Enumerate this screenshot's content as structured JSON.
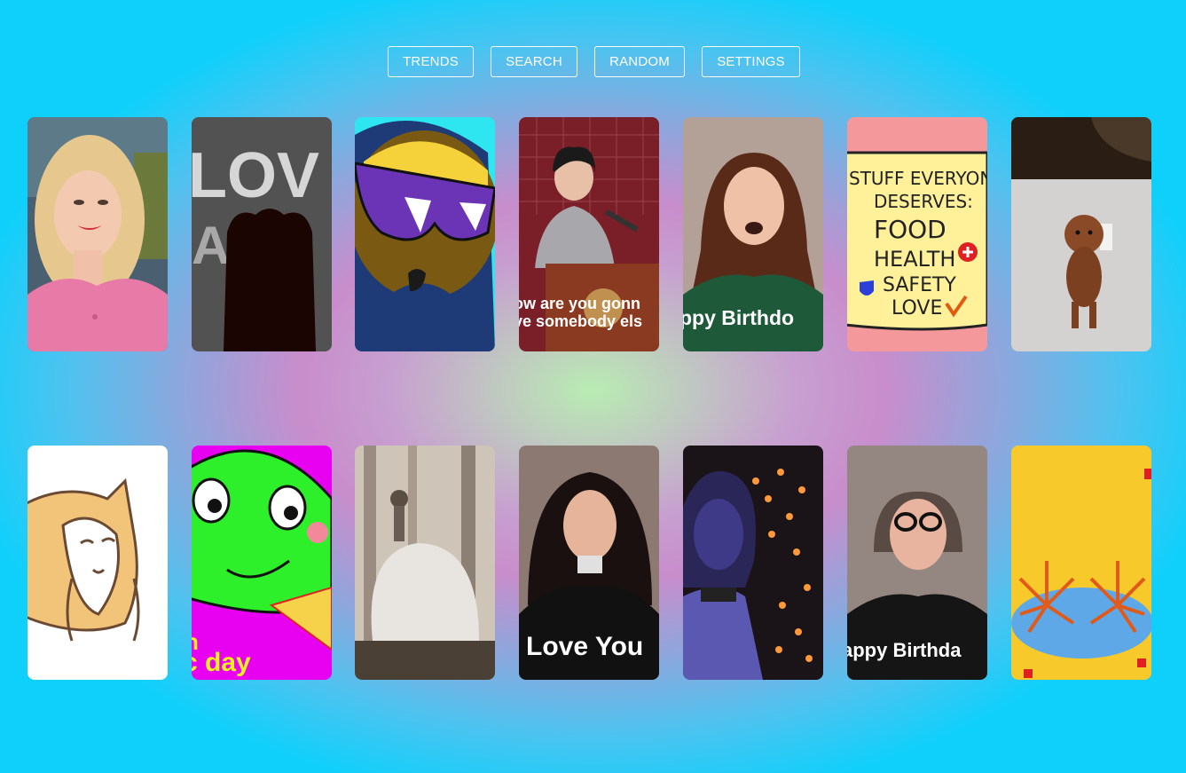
{
  "nav": {
    "trends": "TRENDS",
    "search": "SEARCH",
    "random": "RANDOM",
    "settings": "SETTINGS"
  },
  "gifs": {
    "row1": [
      {
        "icon": "woman-blonde-smiling-gif",
        "caption": ""
      },
      {
        "icon": "love-text-silhouette-gif",
        "caption": "LOV"
      },
      {
        "icon": "cartoon-sunglasses-gif",
        "caption": ""
      },
      {
        "icon": "woman-podium-speech-gif",
        "caption": "ow are you gonn",
        "caption2": "ve somebody els"
      },
      {
        "icon": "woman-birthday-gif",
        "caption": "ppy Birthdo"
      },
      {
        "icon": "notepad-stuff-everyone-deserves-gif",
        "lines": [
          "STUFF EVERYONE",
          "DESERVES:",
          "FOOD",
          "HEALTH",
          "SAFETY",
          "LOVE"
        ]
      },
      {
        "icon": "poodle-dog-gif",
        "caption": ""
      }
    ],
    "row2": [
      {
        "icon": "cartoon-corgi-gif",
        "caption": ""
      },
      {
        "icon": "cartoon-frog-pizza-gif",
        "caption": "c day",
        "caption2": "n"
      },
      {
        "icon": "cat-forest-gif",
        "caption": ""
      },
      {
        "icon": "woman-love-you-gif",
        "caption": "Love You"
      },
      {
        "icon": "woman-lights-gif",
        "caption": ""
      },
      {
        "icon": "woman-glasses-birthday-gif",
        "caption": "appy Birthda"
      },
      {
        "icon": "cartoon-crab-yellow-gif",
        "caption": ""
      }
    ]
  },
  "colors": {
    "background_center": "#b9ecb3",
    "background_mid": "#c88dcb",
    "background_edge": "#0fd0fb",
    "button_border": "#ffffff"
  }
}
